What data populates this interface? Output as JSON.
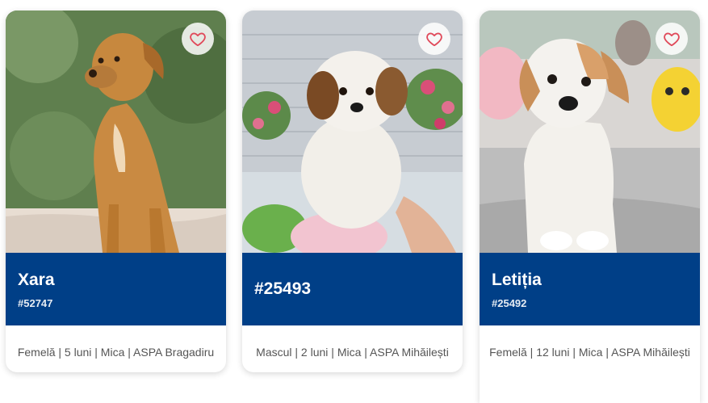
{
  "colors": {
    "band": "#003f87",
    "heart": "#e04a5a"
  },
  "cards": [
    {
      "name": "Xara",
      "id": "#52747",
      "details": "Femelă | 5 luni | Mica | ASPA Bragadiru",
      "favorite_icon": "heart-outline-icon"
    },
    {
      "name": "#25493",
      "id": "",
      "details": "Mascul | 2 luni | Mica | ASPA Mihăilești",
      "favorite_icon": "heart-outline-icon"
    },
    {
      "name": "Letiția",
      "id": "#25492",
      "details": "Femelă | 12 luni | Mica | ASPA Mihăilești",
      "favorite_icon": "heart-outline-icon"
    }
  ]
}
